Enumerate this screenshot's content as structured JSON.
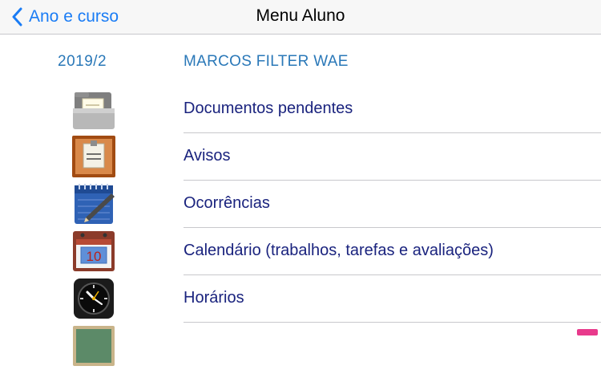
{
  "navbar": {
    "back_label": "Ano e curso",
    "title": "Menu Aluno"
  },
  "info": {
    "year": "2019/2",
    "student_name": "MARCOS FILTER WAE"
  },
  "menu": {
    "items": [
      {
        "label": "Documentos pendentes",
        "icon": "folder-documents-icon"
      },
      {
        "label": "Avisos",
        "icon": "bulletin-board-icon"
      },
      {
        "label": "Ocorrências",
        "icon": "notebook-pencil-icon"
      },
      {
        "label": "Calendário (trabalhos, tarefas e avaliações)",
        "icon": "calendar-icon"
      },
      {
        "label": "Horários",
        "icon": "clock-icon"
      },
      {
        "label": "",
        "icon": "chalkboard-icon"
      }
    ]
  },
  "colors": {
    "accent": "#1a7cf5",
    "info_text": "#2a78b8",
    "item_text": "#1a237e",
    "separator": "#c8c8cc"
  }
}
